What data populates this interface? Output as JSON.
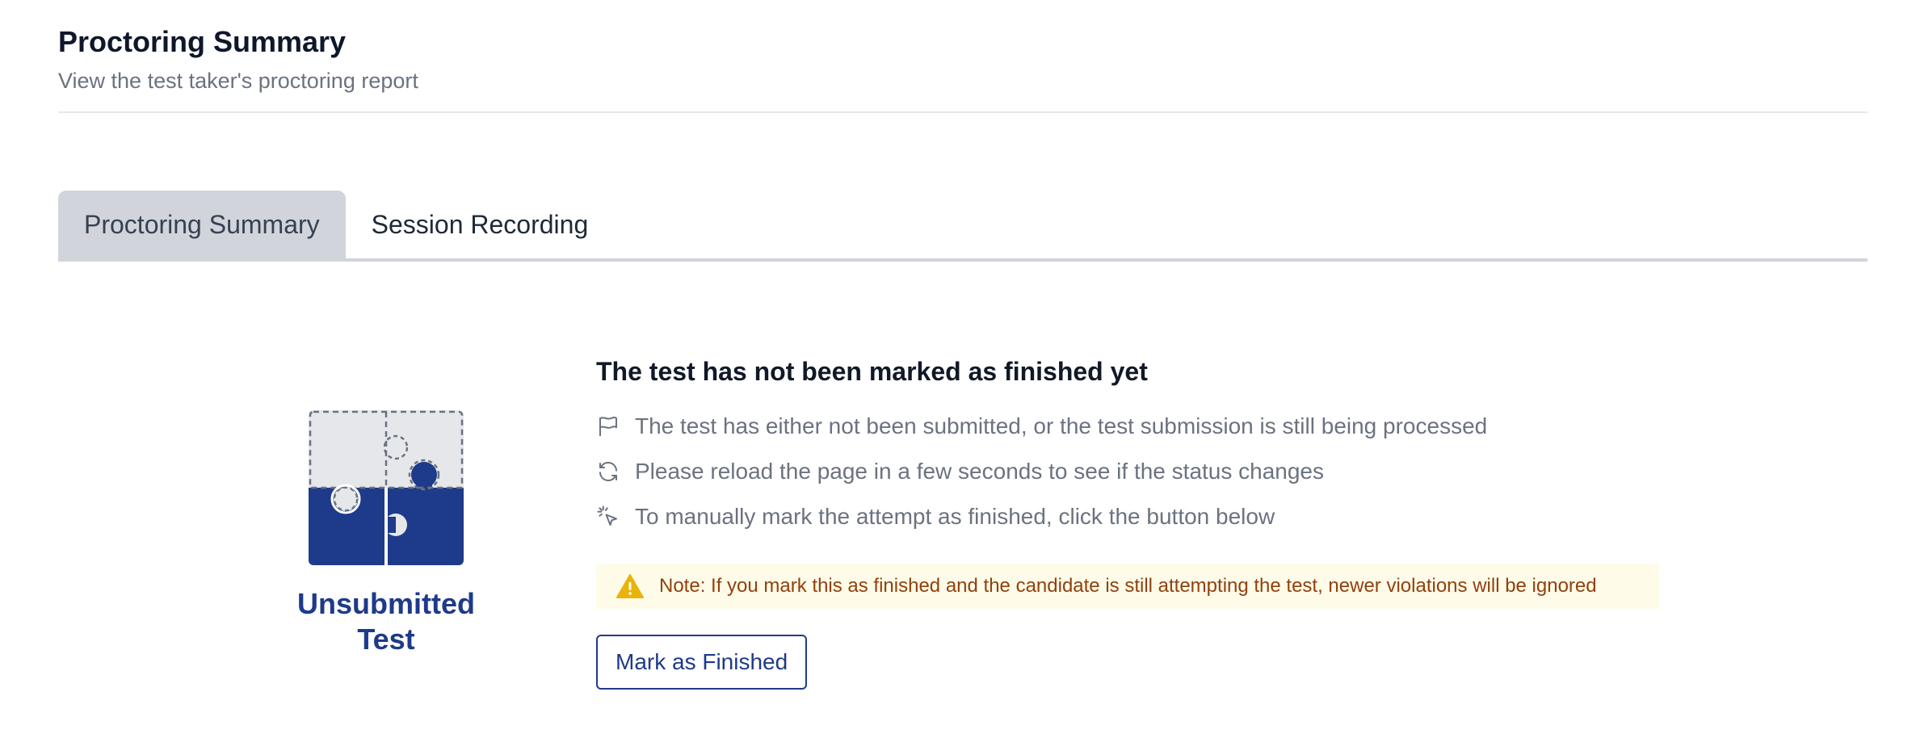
{
  "header": {
    "title": "Proctoring Summary",
    "subtitle": "View the test taker's proctoring report"
  },
  "tabs": [
    {
      "label": "Proctoring Summary",
      "active": true
    },
    {
      "label": "Session Recording",
      "active": false
    }
  ],
  "illustration": {
    "icon": "puzzle-icon",
    "status_label": "Unsubmitted Test"
  },
  "content": {
    "title": "The test has not been marked as finished yet",
    "items": [
      {
        "icon": "flag-icon",
        "text": "The test has either not been submitted, or the test submission is still being processed"
      },
      {
        "icon": "refresh-icon",
        "text": "Please reload the page in a few seconds to see if the status changes"
      },
      {
        "icon": "click-pointer-icon",
        "text": "To manually mark the attempt as finished, click the button below"
      }
    ],
    "warning": {
      "icon": "warning-icon",
      "text": "Note: If you mark this as finished and the candidate is still attempting the test, newer violations will be ignored"
    },
    "button_label": "Mark as Finished"
  },
  "colors": {
    "accent": "#1e3a8a",
    "tab_active_bg": "#d1d5db",
    "muted_text": "#6b7280",
    "warning_bg": "#fefce8",
    "warning_text": "#92400e",
    "warning_icon": "#eab308"
  }
}
